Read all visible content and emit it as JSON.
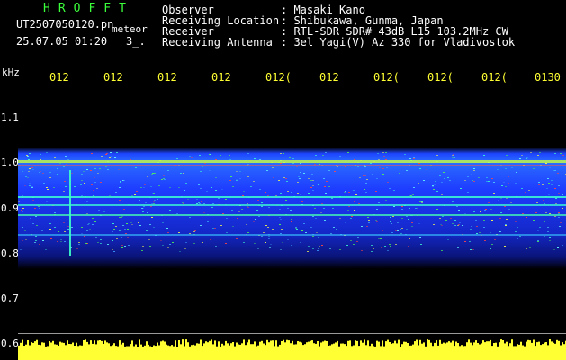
{
  "header": {
    "app_title": "HROFFT",
    "filename": "UT2507050120.pn",
    "filename_suffix": "meteor",
    "datetime": "25.07.05 01:20",
    "extra": "3_.",
    "meta": [
      {
        "key": "Observer",
        "value": ": Masaki Kano"
      },
      {
        "key": "Receiving Location",
        "value": ": Shibukawa, Gunma, Japan"
      },
      {
        "key": "Receiver",
        "value": ": RTL-SDR SDR# 43dB L15 103.2MHz CW"
      },
      {
        "key": "Receiving Antenna",
        "value": ": 3el Yagi(V) Az 330 for Vladivostok"
      }
    ]
  },
  "axis": {
    "unit": "kHz",
    "y_ticks": [
      "1.1",
      "1.0",
      "0.9",
      "0.8",
      "0.7",
      "0.6"
    ],
    "x_ticks": [
      "012",
      "012",
      "012",
      "012",
      "012(",
      "012",
      "012(",
      "012(",
      "012(",
      "0130"
    ]
  },
  "colors": {
    "background": "#000000",
    "title": "#3cff3c",
    "labels": "#ffffff",
    "time_ticks": "#ffff33",
    "power_bar": "#ffff33",
    "signal_band": "#1e3cff"
  }
}
